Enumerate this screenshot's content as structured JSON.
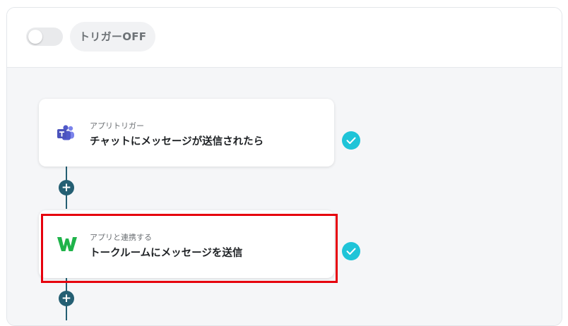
{
  "topbar": {
    "toggle_state": "off",
    "trigger_status": "トリガーOFF"
  },
  "flow": {
    "steps": [
      {
        "subtitle": "アプリトリガー",
        "title": "チャットにメッセージが送信されたら",
        "app_icon": "microsoft-teams-icon",
        "status": "completed"
      },
      {
        "subtitle": "アプリと連携する",
        "title": "トークルームにメッセージを送信",
        "app_icon": "lineworks-icon",
        "status": "completed",
        "highlighted": true
      }
    ],
    "add_step_symbol": "+"
  },
  "colors": {
    "accent_check": "#1fc4d8",
    "connector": "#245f73",
    "highlight_border": "#e6000d",
    "teams_purple": "#5059c9",
    "lineworks_green": "#1fb34a"
  }
}
